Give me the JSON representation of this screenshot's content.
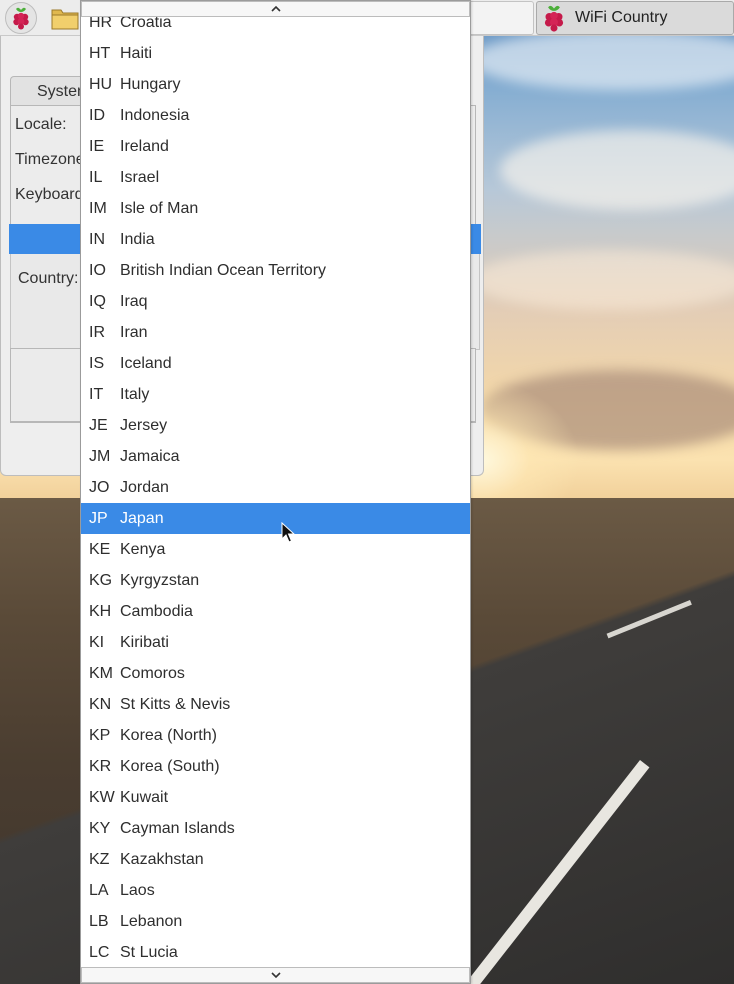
{
  "panel": {
    "menu_icon": "raspberry-pi-icon",
    "file_manager_icon": "folder-icon",
    "window_button_label": "WiFi Country"
  },
  "dialog": {
    "tab_label": "System",
    "locale_label": "Locale:",
    "timezone_label": "Timezone",
    "keyboard_label": "Keyboard",
    "country_label": "Country:"
  },
  "dropdown": {
    "scroll_up_icon": "chevron-up-icon",
    "scroll_down_icon": "chevron-down-icon",
    "selected_code": "JP",
    "highlight_color": "#3a8ae6",
    "items": [
      {
        "code": "HR",
        "name": "Croatia"
      },
      {
        "code": "HT",
        "name": "Haiti"
      },
      {
        "code": "HU",
        "name": "Hungary"
      },
      {
        "code": "ID",
        "name": "Indonesia"
      },
      {
        "code": "IE",
        "name": "Ireland"
      },
      {
        "code": "IL",
        "name": "Israel"
      },
      {
        "code": "IM",
        "name": "Isle of Man"
      },
      {
        "code": "IN",
        "name": "India"
      },
      {
        "code": "IO",
        "name": "British Indian Ocean Territory"
      },
      {
        "code": "IQ",
        "name": "Iraq"
      },
      {
        "code": "IR",
        "name": "Iran"
      },
      {
        "code": "IS",
        "name": "Iceland"
      },
      {
        "code": "IT",
        "name": "Italy"
      },
      {
        "code": "JE",
        "name": "Jersey"
      },
      {
        "code": "JM",
        "name": "Jamaica"
      },
      {
        "code": "JO",
        "name": "Jordan"
      },
      {
        "code": "JP",
        "name": "Japan"
      },
      {
        "code": "KE",
        "name": "Kenya"
      },
      {
        "code": "KG",
        "name": "Kyrgyzstan"
      },
      {
        "code": "KH",
        "name": "Cambodia"
      },
      {
        "code": "KI",
        "name": "Kiribati"
      },
      {
        "code": "KM",
        "name": "Comoros"
      },
      {
        "code": "KN",
        "name": "St Kitts & Nevis"
      },
      {
        "code": "KP",
        "name": "Korea (North)"
      },
      {
        "code": "KR",
        "name": "Korea (South)"
      },
      {
        "code": "KW",
        "name": "Kuwait"
      },
      {
        "code": "KY",
        "name": "Cayman Islands"
      },
      {
        "code": "KZ",
        "name": "Kazakhstan"
      },
      {
        "code": "LA",
        "name": "Laos"
      },
      {
        "code": "LB",
        "name": "Lebanon"
      },
      {
        "code": "LC",
        "name": "St Lucia"
      }
    ]
  }
}
